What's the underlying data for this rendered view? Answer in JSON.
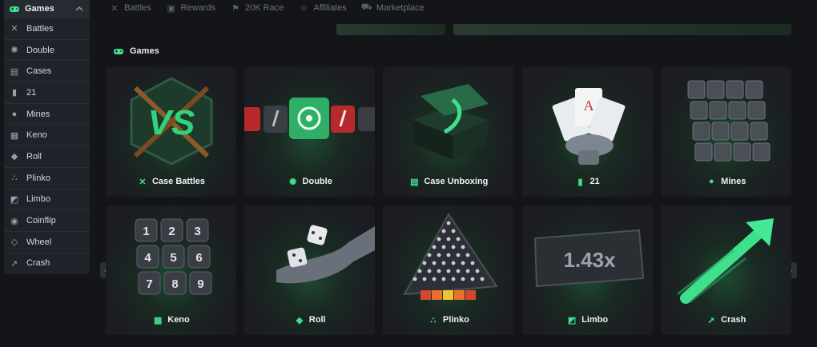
{
  "sidebar": {
    "header": {
      "label": "Games",
      "icon": "gamepad-icon"
    },
    "items": [
      {
        "label": "Battles",
        "icon": "crossed-swords-icon"
      },
      {
        "label": "Double",
        "icon": "dice-icon"
      },
      {
        "label": "Cases",
        "icon": "box-icon"
      },
      {
        "label": "21",
        "icon": "cards-icon"
      },
      {
        "label": "Mines",
        "icon": "bomb-icon"
      },
      {
        "label": "Keno",
        "icon": "grid-icon"
      },
      {
        "label": "Roll",
        "icon": "dice-cube-icon"
      },
      {
        "label": "Plinko",
        "icon": "dots-triangle-icon"
      },
      {
        "label": "Limbo",
        "icon": "limbo-icon"
      },
      {
        "label": "Coinflip",
        "icon": "coin-icon"
      },
      {
        "label": "Wheel",
        "icon": "diamond-icon"
      },
      {
        "label": "Crash",
        "icon": "arrow-up-right-icon"
      }
    ]
  },
  "topnav": [
    {
      "label": "Battles",
      "icon": "crossed-swords-icon"
    },
    {
      "label": "Rewards",
      "icon": "gift-icon"
    },
    {
      "label": "20K Race",
      "icon": "flag-icon"
    },
    {
      "label": "Affiliates",
      "icon": "users-icon"
    },
    {
      "label": "Marketplace",
      "icon": "cart-icon"
    }
  ],
  "section": {
    "title": "Games",
    "icon": "gamepad-icon"
  },
  "cards": [
    {
      "label": "Case Battles",
      "icon": "crossed-swords-icon"
    },
    {
      "label": "Double",
      "icon": "dice-icon"
    },
    {
      "label": "Case Unboxing",
      "icon": "box-icon"
    },
    {
      "label": "21",
      "icon": "cards-icon"
    },
    {
      "label": "Mines",
      "icon": "bomb-icon"
    },
    {
      "label": "Keno",
      "icon": "grid-icon"
    },
    {
      "label": "Roll",
      "icon": "dice-cube-icon"
    },
    {
      "label": "Plinko",
      "icon": "dots-triangle-icon"
    },
    {
      "label": "Limbo",
      "icon": "limbo-icon"
    },
    {
      "label": "Crash",
      "icon": "arrow-up-right-icon"
    }
  ],
  "art": {
    "case_battles_text": "VS",
    "limbo_multiplier": "1.43x",
    "keno_numbers": [
      "1",
      "2",
      "3",
      "4",
      "5",
      "6",
      "7",
      "8",
      "9"
    ]
  },
  "colors": {
    "accent": "#3fe08c",
    "background": "#141518",
    "card": "#1b1d22"
  }
}
